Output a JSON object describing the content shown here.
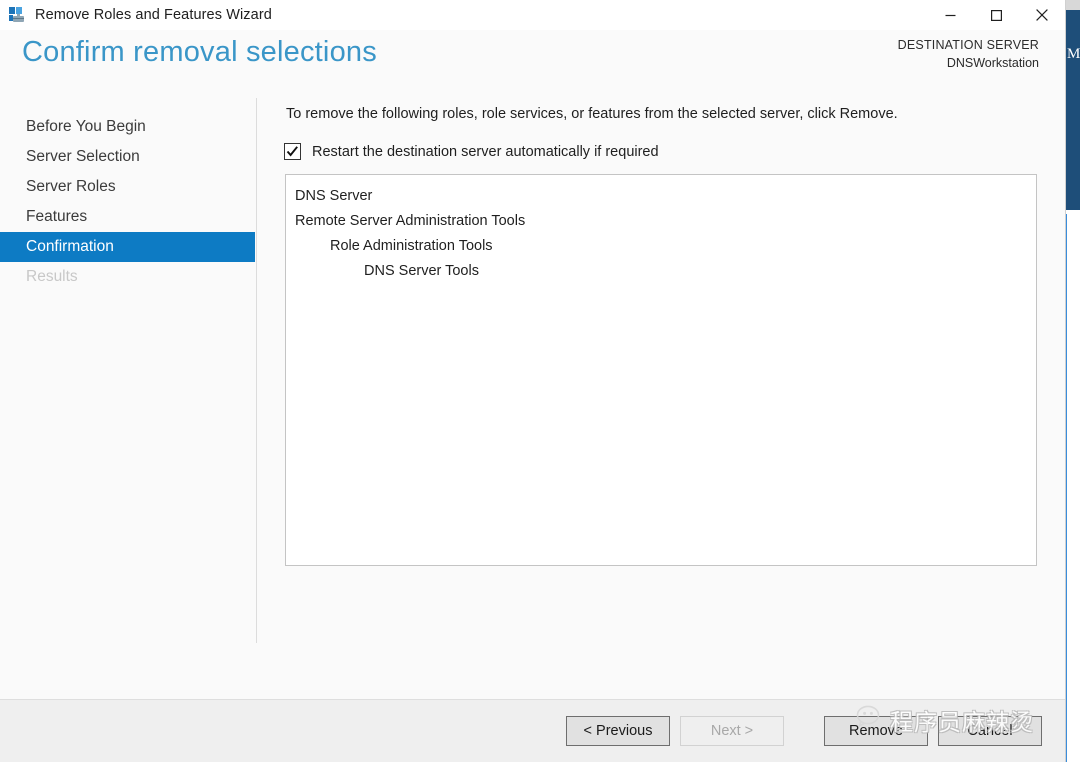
{
  "window": {
    "title": "Remove Roles and Features Wizard",
    "app_icon": "server-toolbox-icon",
    "controls": {
      "minimize": "minimize-icon",
      "maximize": "maximize-icon",
      "close": "close-icon"
    }
  },
  "header": {
    "title": "Confirm removal selections",
    "title_color": "#3a96c8",
    "destination_label": "DESTINATION SERVER",
    "destination_value": "DNSWorkstation"
  },
  "sidebar": {
    "accent_color": "#0d7bc4",
    "items": [
      {
        "label": "Before You Begin",
        "state": "normal"
      },
      {
        "label": "Server Selection",
        "state": "normal"
      },
      {
        "label": "Server Roles",
        "state": "normal"
      },
      {
        "label": "Features",
        "state": "normal"
      },
      {
        "label": "Confirmation",
        "state": "selected"
      },
      {
        "label": "Results",
        "state": "disabled"
      }
    ]
  },
  "main": {
    "instruction": "To remove the following roles, role services, or features from the selected server, click Remove.",
    "restart_checkbox": {
      "label": "Restart the destination server automatically if required",
      "checked": true
    },
    "selection_list": [
      {
        "label": "DNS Server",
        "level": 0
      },
      {
        "label": "Remote Server Administration Tools",
        "level": 0
      },
      {
        "label": "Role Administration Tools",
        "level": 1
      },
      {
        "label": "DNS Server Tools",
        "level": 2
      }
    ]
  },
  "annotation": {
    "arrow_color": "#e8412a",
    "arrow_name": "red-pointer-arrow"
  },
  "footer": {
    "buttons": [
      {
        "label": "< Previous",
        "name": "previous-button",
        "state": "enabled"
      },
      {
        "label": "Next >",
        "name": "next-button",
        "state": "disabled"
      },
      {
        "label": "Remove",
        "name": "remove-button",
        "state": "enabled"
      },
      {
        "label": "Cancel",
        "name": "cancel-button",
        "state": "enabled"
      }
    ]
  },
  "watermark": {
    "text": "程序员麻辣烫",
    "icon": "wechat-icon"
  },
  "background_window": {
    "visible_letter": "M"
  }
}
